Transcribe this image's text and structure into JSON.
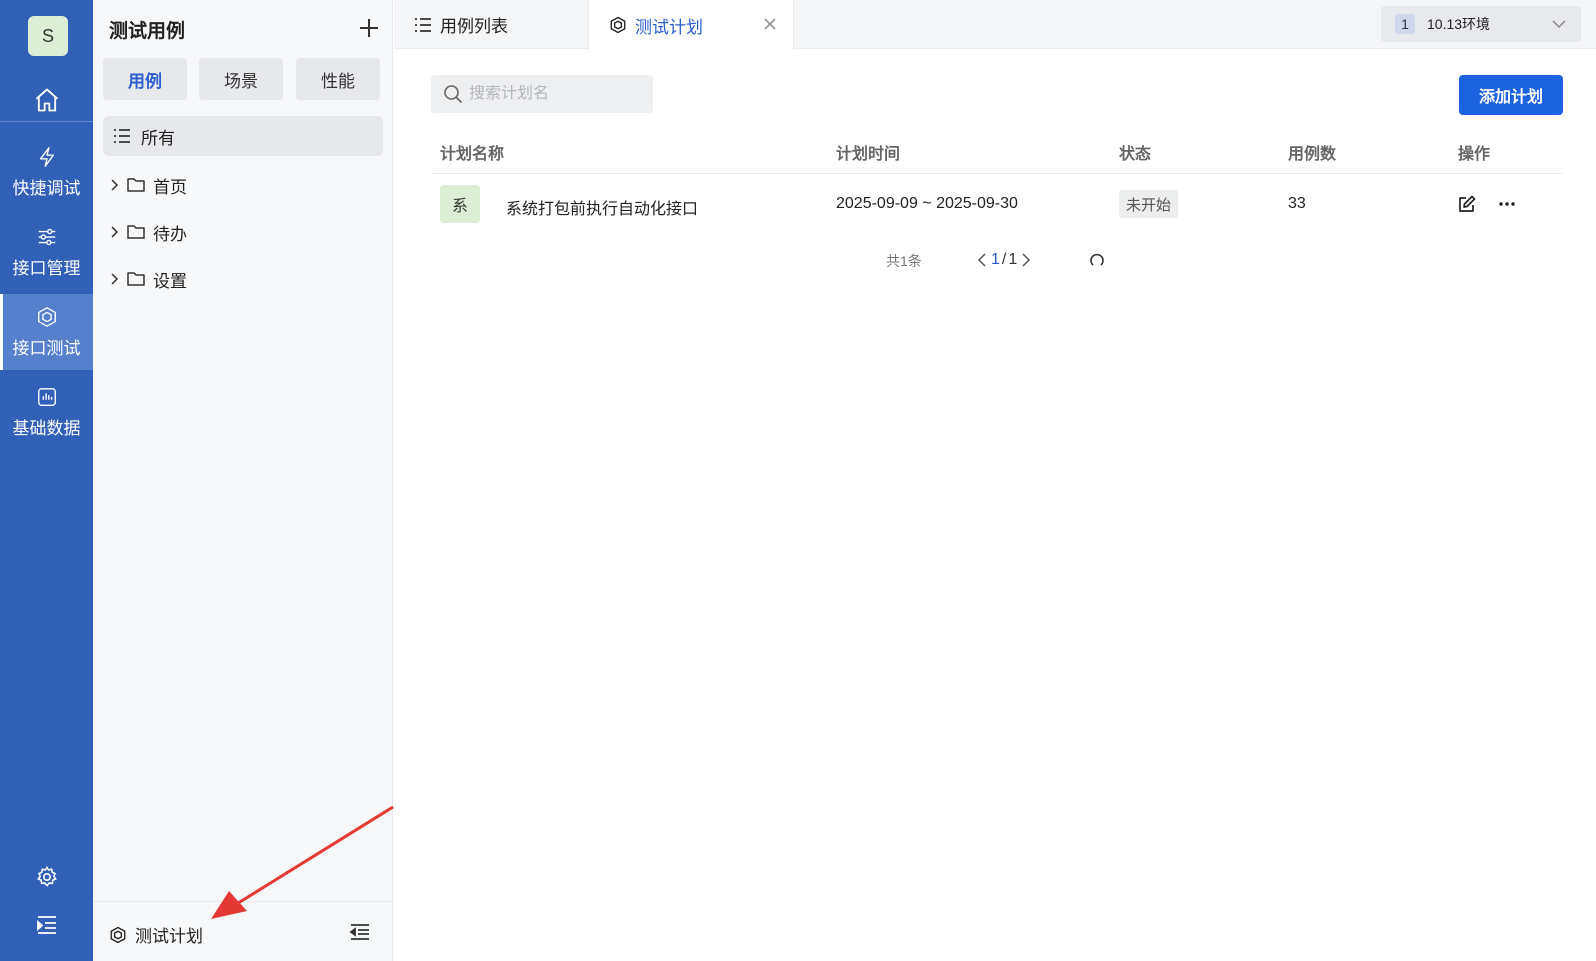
{
  "rail": {
    "avatar_letter": "S",
    "items": [
      {
        "label": "快捷调试",
        "icon": "lightning-icon"
      },
      {
        "label": "接口管理",
        "icon": "sliders-icon"
      },
      {
        "label": "接口测试",
        "icon": "cube-icon",
        "active": true
      },
      {
        "label": "基础数据",
        "icon": "chart-icon"
      }
    ]
  },
  "sidebar": {
    "title": "测试用例",
    "segments": [
      "用例",
      "场景",
      "性能"
    ],
    "active_segment": "用例",
    "tree": {
      "all_label": "所有",
      "folders": [
        "首页",
        "待办",
        "设置"
      ]
    },
    "footer_label": "测试计划"
  },
  "tabs": {
    "items": [
      {
        "label": "用例列表",
        "icon": "list-icon"
      },
      {
        "label": "测试计划",
        "icon": "cube-icon",
        "active": true
      }
    ]
  },
  "env": {
    "badge": "1",
    "label": "10.13环境"
  },
  "main": {
    "search_placeholder": "搜索计划名",
    "add_button": "添加计划",
    "columns": [
      "计划名称",
      "计划时间",
      "状态",
      "用例数",
      "操作"
    ],
    "rows": [
      {
        "avatar": "系",
        "name": "系统打包前执行自动化接口",
        "time": "2025-09-09 ~ 2025-09-30",
        "status": "未开始",
        "count": "33"
      }
    ],
    "pager": {
      "total": "共1条",
      "current": "1",
      "separator": "/",
      "pages": "1"
    }
  },
  "colors": {
    "rail": "#3160b8",
    "accent": "#1d63e0",
    "avatar_bg": "#dcefd6",
    "annotation_arrow": "#e53935"
  }
}
